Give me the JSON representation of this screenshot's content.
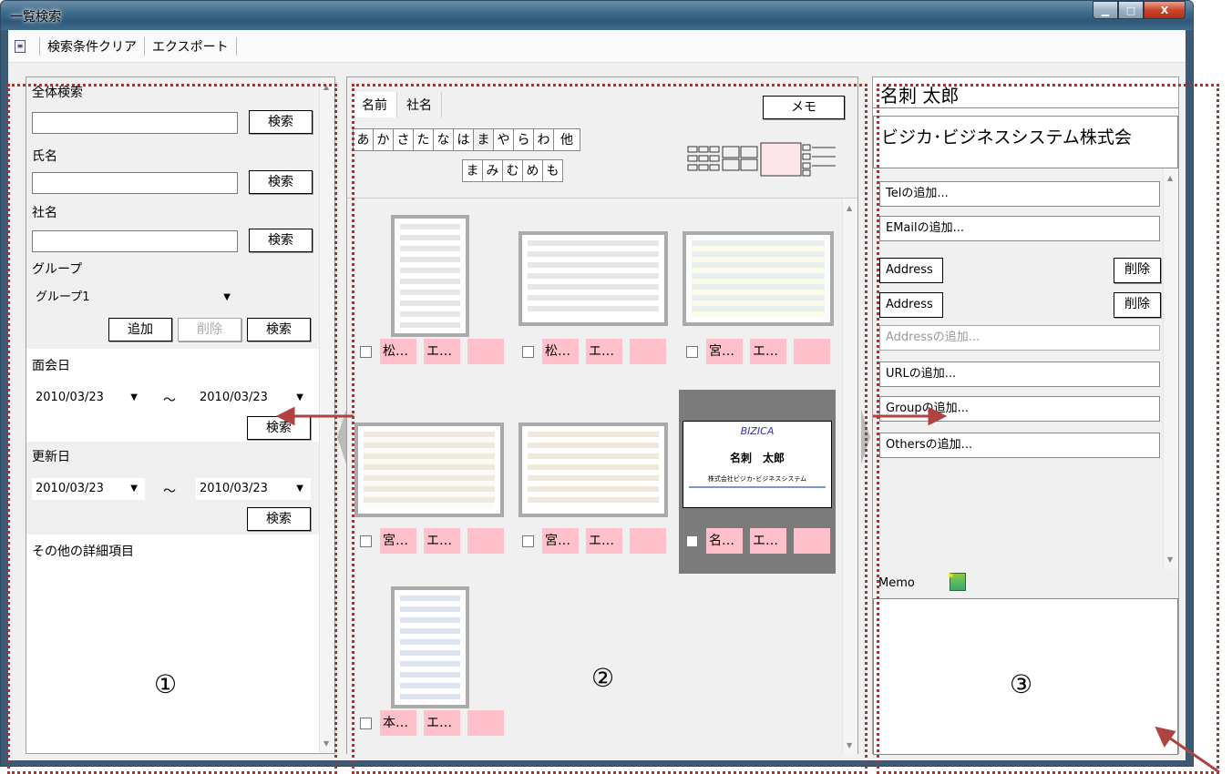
{
  "window": {
    "title": "一覧検索",
    "minimize": "▁",
    "maximize": "□",
    "close": "X"
  },
  "toolbar": {
    "icon": "document-icon",
    "clear": "検索条件クリア",
    "export": "エクスポート"
  },
  "left": {
    "all_search_label": "全体検索",
    "search": "検索",
    "name_label": "氏名",
    "company_label": "社名",
    "group_label": "グループ",
    "group_value": "グループ1",
    "add": "追加",
    "delete": "削除",
    "meeting_label": "面会日",
    "meeting_from": "2010/03/23",
    "meeting_to": "2010/03/23",
    "update_label": "更新日",
    "update_from": "2010/03/23",
    "update_to": "2010/03/23",
    "tilde": "〜",
    "more_label": "その他の詳細項目",
    "marker": "①"
  },
  "middle": {
    "tabs": [
      "名前",
      "社名"
    ],
    "memo": "メモ",
    "kana_row1": [
      "あ",
      "か",
      "さ",
      "た",
      "な",
      "は",
      "ま",
      "や",
      "ら",
      "わ",
      "他"
    ],
    "kana_row2": [
      "ま",
      "み",
      "む",
      "め",
      "も"
    ],
    "cards": [
      {
        "name": "松…",
        "co": "エ…"
      },
      {
        "name": "松…",
        "co": "エ…"
      },
      {
        "name": "宮…",
        "co": "エ…"
      },
      {
        "name": "宮…",
        "co": "エ…"
      },
      {
        "name": "宮…",
        "co": "エ…"
      },
      {
        "name": "名…",
        "co": "エ…"
      },
      {
        "name": "本…",
        "co": "エ…"
      }
    ],
    "selected_card": {
      "logo": "BIZICA",
      "person": "名刺　太郎",
      "company": "株式会社ビジカ･ビジネスシステム"
    },
    "marker": "②"
  },
  "right": {
    "name": "名刺 太郎",
    "company": "ビジカ･ビジネスシステム株式会",
    "tel_add": "Telの追加...",
    "email_add": "EMailの追加...",
    "address": "Address",
    "delete": "削除",
    "address_add": "Addressの追加...",
    "url_add": "URLの追加...",
    "group_add": "Groupの追加...",
    "others_add": "Othersの追加...",
    "memo_label": "Memo",
    "marker": "③"
  }
}
